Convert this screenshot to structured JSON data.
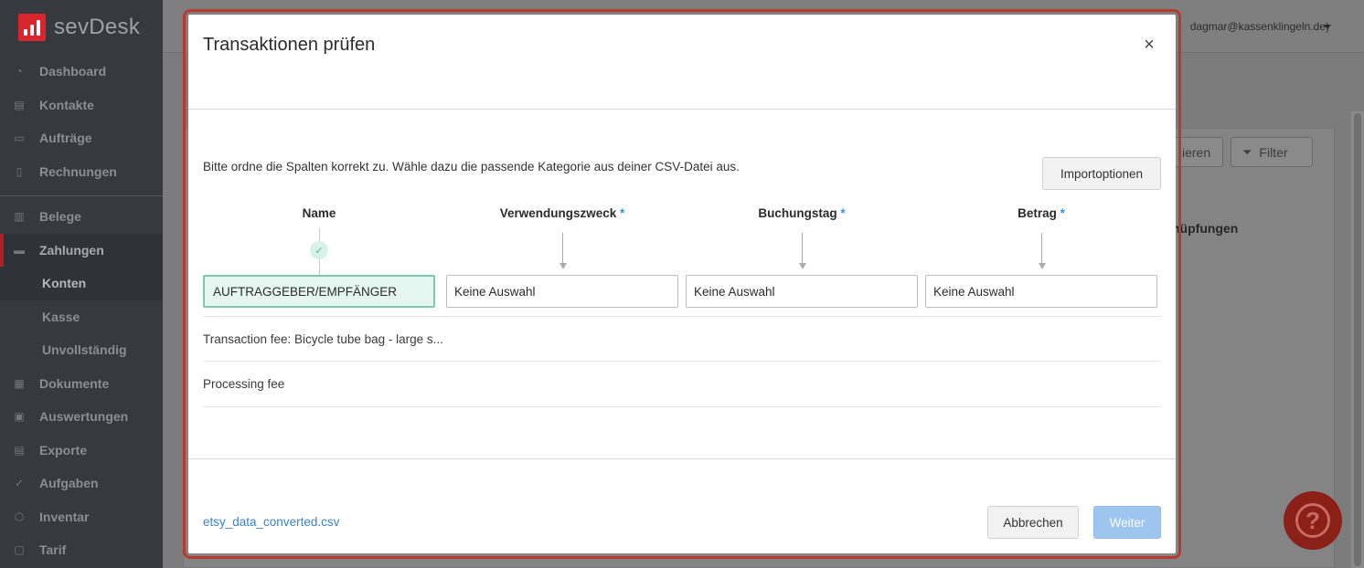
{
  "sidebar": {
    "logo_text": "sevDesk",
    "items": [
      {
        "label": "Dashboard",
        "icon": "dashboard-icon",
        "glyph": "◔"
      },
      {
        "label": "Kontakte",
        "icon": "contacts-icon",
        "glyph": "▤"
      },
      {
        "label": "Aufträge",
        "icon": "folder-icon",
        "glyph": "▭"
      },
      {
        "label": "Rechnungen",
        "icon": "invoice-icon",
        "glyph": "▯"
      }
    ],
    "items2": [
      {
        "label": "Belege",
        "icon": "receipt-icon",
        "glyph": "▥"
      },
      {
        "label": "Zahlungen",
        "icon": "payments-icon",
        "glyph": "▬"
      },
      {
        "label": "Konten",
        "sub": true
      },
      {
        "label": "Kasse",
        "sub": true
      },
      {
        "label": "Unvollständig",
        "sub": true
      },
      {
        "label": "Dokumente",
        "icon": "documents-icon",
        "glyph": "▦"
      },
      {
        "label": "Auswertungen",
        "icon": "reports-icon",
        "glyph": "▣"
      },
      {
        "label": "Exporte",
        "icon": "export-icon",
        "glyph": "▤"
      },
      {
        "label": "Aufgaben",
        "icon": "check-icon",
        "glyph": "✓"
      },
      {
        "label": "Inventar",
        "icon": "inventory-icon",
        "glyph": "⬡"
      },
      {
        "label": "Tarif",
        "icon": "tariff-icon",
        "glyph": "▢"
      }
    ]
  },
  "background": {
    "user_email": "dagmar@kassenklingeln.de)",
    "btn_partial": "ieren",
    "filter_label": "Filter",
    "column_partial": "nüpfungen"
  },
  "modal": {
    "title": "Transaktionen prüfen",
    "close_glyph": "×",
    "intro": "Bitte ordne die Spalten korrekt zu. Wähle dazu die passende Kategorie aus deiner CSV-Datei aus.",
    "import_options_label": "Importoptionen",
    "columns": [
      {
        "header": "Name",
        "required": false,
        "selected": "AUFTRAGGEBER/EMPFÄNGER",
        "mapped": true
      },
      {
        "header": "Verwendungszweck",
        "required": true,
        "selected": "Keine Auswahl",
        "mapped": false
      },
      {
        "header": "Buchungstag",
        "required": true,
        "selected": "Keine Auswahl",
        "mapped": false
      },
      {
        "header": "Betrag",
        "required": true,
        "selected": "Keine Auswahl",
        "mapped": false
      }
    ],
    "required_marker": "*",
    "preview_rows": [
      "Transaction fee: Bicycle tube bag - large s...",
      "Processing fee"
    ],
    "file_name": "etsy_data_converted.csv",
    "cancel_label": "Abbrechen",
    "next_label": "Weiter"
  },
  "colors": {
    "accent_red": "#d9262e",
    "mapped_green": "#7cc7b0",
    "primary_blue_disabled": "#9ec5ee",
    "link_blue": "#3c82c6"
  }
}
